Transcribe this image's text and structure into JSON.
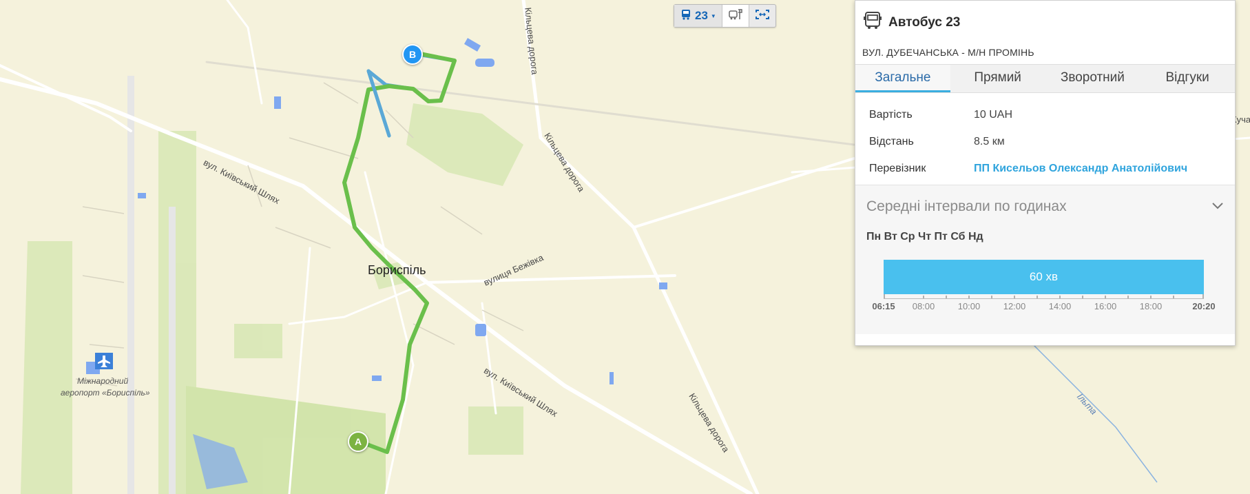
{
  "map": {
    "labels": {
      "city": "Бориспіль",
      "road_kyivskyi_1": "вул. Київський Шлях",
      "road_kyivskyi_2": "вул. Київський Шлях",
      "ring_road_1": "Кільцева дорога",
      "ring_road_2": "Кільцева дорога",
      "ring_road_3": "Кільцева дорога",
      "bezhivka": "вулиця Бежівка",
      "airport_line1": "Міжнародний",
      "airport_line2": "аеропорт «Бориспіль»",
      "river": "Ільта",
      "edge_label": "Куча"
    },
    "markers": {
      "a": "A",
      "b": "B"
    },
    "colors": {
      "route": "#6abf4b",
      "route_alt": "#5aa8d6",
      "water": "#7fa8f0"
    }
  },
  "toolbar": {
    "route_number": "23",
    "icons": [
      "bus-icon",
      "bus-stops-icon",
      "fit-bounds-icon"
    ]
  },
  "panel": {
    "title": "Автобус 23",
    "subtitle": "ВУЛ. ДУБЕЧАНСЬКА - М/Н ПРОМІНЬ",
    "tabs": [
      "Загальне",
      "Прямий",
      "Зворотний",
      "Відгуки"
    ],
    "active_tab": "Загальне",
    "info": [
      {
        "label": "Вартість",
        "value": "10 UAH"
      },
      {
        "label": "Відстань",
        "value": "8.5 км"
      },
      {
        "label": "Перевізник",
        "value": "ПП Кисельов Олександр Анатолійович"
      }
    ],
    "intervals": {
      "title": "Середні інтервали по годинах",
      "days": "Пн Вт Ср Чт Пт Сб Нд",
      "bar_label": "60 хв",
      "start": "06:15",
      "end": "20:20",
      "ticks": [
        "08:00",
        "10:00",
        "12:00",
        "14:00",
        "16:00",
        "18:00"
      ]
    }
  }
}
